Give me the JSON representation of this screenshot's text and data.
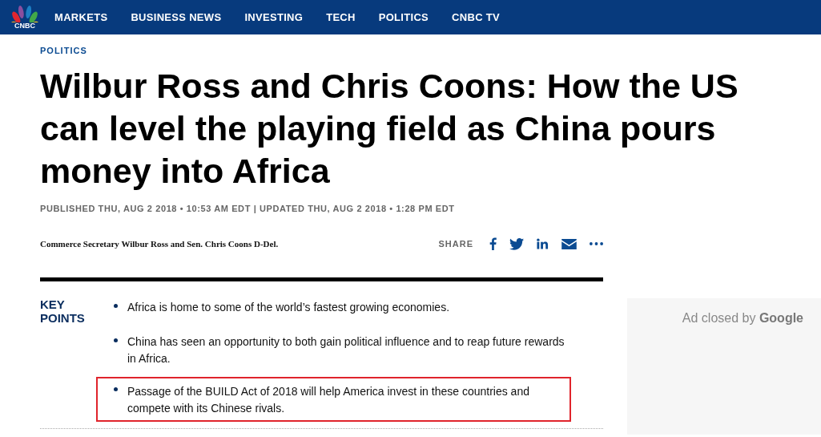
{
  "nav": {
    "logo_text": "CNBC",
    "items": [
      "MARKETS",
      "BUSINESS NEWS",
      "INVESTING",
      "TECH",
      "POLITICS",
      "CNBC TV"
    ]
  },
  "article": {
    "section": "POLITICS",
    "headline": "Wilbur Ross and Chris Coons: How the US can level the playing field as China pours money into Africa",
    "timestamp": "PUBLISHED THU, AUG 2 2018 • 10:53 AM EDT | UPDATED THU, AUG 2 2018 • 1:28 PM EDT",
    "byline": "Commerce Secretary Wilbur Ross and Sen. Chris Coons D-Del.",
    "share_label": "SHARE",
    "share_buttons": [
      {
        "kind": "facebook"
      },
      {
        "kind": "twitter"
      },
      {
        "kind": "linkedin"
      },
      {
        "kind": "email"
      },
      {
        "kind": "more"
      }
    ],
    "key_points_title": "KEY POINTS",
    "key_points": [
      {
        "text": "Africa is home to some of the world’s fastest growing economies.",
        "highlighted": false
      },
      {
        "text": "China has seen an opportunity to both gain political influence and to reap future rewards in Africa.",
        "highlighted": false
      },
      {
        "text": "Passage of the BUILD Act of 2018 will help America invest in these countries and compete with its Chinese rivals.",
        "highlighted": true
      }
    ]
  },
  "ad": {
    "text": "Ad closed by **Google**"
  }
}
